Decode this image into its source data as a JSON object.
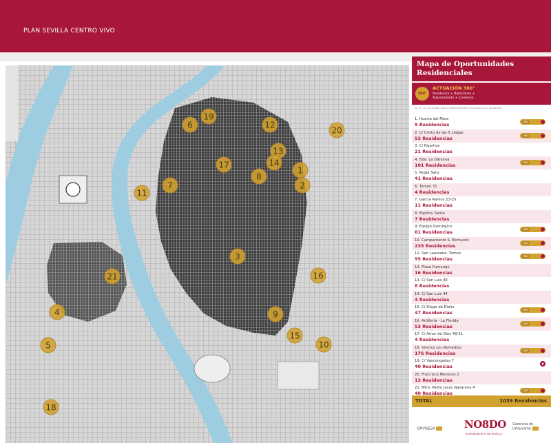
{
  "header": {
    "title": "PLAN SEVILLA CENTRO VIVO"
  },
  "panel": {
    "title_line1": "Mapa de Oportunidades",
    "title_line2": "Residenciales",
    "actuacion": {
      "badge": "360°",
      "label": "ACTUACIÓN 360°",
      "desc": "Residencia + Dotaciones + Aparcamiento + Comercio"
    },
    "note": "La \"P\" en los fichas indica APARCAMIENTO incluido en la actuación",
    "items": [
      {
        "name": "1. Huerta del Moro",
        "residencias": "9 Residencias",
        "badge": "360"
      },
      {
        "name": "2. C/ Cristo de las 5 Llagas",
        "residencias": "53 Residencias",
        "badge": "360"
      },
      {
        "name": "3. C/ Pajaritos",
        "residencias": "21 Residencias",
        "badge": ""
      },
      {
        "name": "4. Bda. La Dársena",
        "residencias": "101 Residencias",
        "badge": "360"
      },
      {
        "name": "5. Regla Sanz",
        "residencias": "41 Residencias",
        "badge": ""
      },
      {
        "name": "6. Torneo 31",
        "residencias": "4 Residencias",
        "badge": ""
      },
      {
        "name": "7. García Ramos 23-25",
        "residencias": "11 Residencias",
        "badge": ""
      },
      {
        "name": "8. Espíritu Santo",
        "residencias": "7 Residencias",
        "badge": ""
      },
      {
        "name": "9. Equipo Quirúrgico",
        "residencias": "61 Residencias",
        "badge": "360"
      },
      {
        "name": "10. Campamento S. Bernardo",
        "residencias": "235 Residencias",
        "badge": "360"
      },
      {
        "name": "11. San Laureano. Torneo",
        "residencias": "95 Residencias",
        "badge": "360"
      },
      {
        "name": "12. Plaza Pumarejo",
        "residencias": "16 Residencias",
        "badge": ""
      },
      {
        "name": "13. C/ San Luis 40",
        "residencias": "8 Residencias",
        "badge": ""
      },
      {
        "name": "14. C/ San Luis 44",
        "residencias": "4 Residencias",
        "badge": ""
      },
      {
        "name": "15. C/ Diego de Riaño",
        "residencias": "47 Residencias",
        "badge": "360"
      },
      {
        "name": "16. Artillería - La Florida",
        "residencias": "53 Residencias",
        "badge": "360"
      },
      {
        "name": "17. C/ Amor de Dios 49-51",
        "residencias": "4 Residencias",
        "badge": ""
      },
      {
        "name": "18. Viveros Los Remedios",
        "residencias": "176 Residencias",
        "badge": "360"
      },
      {
        "name": "19. C/ Vascongadas 7",
        "residencias": "40 Residencias",
        "badge": "play"
      },
      {
        "name": "20. Francisco Meneses 2",
        "residencias": "13 Residencias",
        "badge": ""
      },
      {
        "name": "21. Mtro. Padre Jesús Nazareno 4",
        "residencias": "40 Residencias",
        "badge": "360"
      }
    ],
    "total": {
      "label": "TOTAL",
      "value": "1039 Residencias"
    }
  },
  "logos": {
    "emvisesa": "EMVISESA",
    "nosdo": "NO8DO",
    "ayuntamiento": "AYUNTAMIENTO DE SEVILLA",
    "gerencia": "Gerencia de Urbanismo"
  },
  "map": {
    "markers": [
      "1",
      "2",
      "3",
      "4",
      "5",
      "6",
      "7",
      "8",
      "9",
      "10",
      "11",
      "12",
      "13",
      "14",
      "15",
      "16",
      "17",
      "18",
      "19",
      "20",
      "21"
    ]
  },
  "colors": {
    "brand": "#a8173a",
    "marker": "#d2a230",
    "river": "#9ecde2"
  }
}
